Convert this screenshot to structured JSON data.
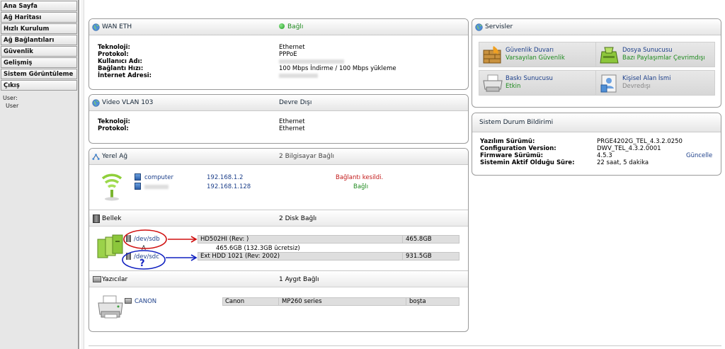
{
  "sidebar": {
    "items": [
      {
        "label": "Ana Sayfa"
      },
      {
        "label": "Ağ Haritası"
      },
      {
        "label": "Hızlı Kurulum"
      },
      {
        "label": "Ağ Bağlantıları"
      },
      {
        "label": "Güvenlik"
      },
      {
        "label": "Gelişmiş"
      },
      {
        "label": "Sistem Görüntüleme"
      },
      {
        "label": "Çıkış"
      }
    ],
    "user_label": "User:",
    "user_value": "User"
  },
  "wan": {
    "title": "WAN ETH",
    "status": "Bağlı",
    "rows": [
      {
        "key": "Teknoloji:",
        "value": "Ethernet"
      },
      {
        "key": "Protokol:",
        "value": "PPPoE"
      },
      {
        "key": "Kullanıcı Adı:",
        "value": ""
      },
      {
        "key": "Bağlantı Hızı:",
        "value": "100 Mbps İndirme / 100 Mbps yükleme"
      },
      {
        "key": "İnternet Adresi:",
        "value": ""
      }
    ]
  },
  "vlan": {
    "title": "Video VLAN 103",
    "status": "Devre Dışı",
    "rows": [
      {
        "key": "Teknoloji:",
        "value": "Ethernet"
      },
      {
        "key": "Protokol:",
        "value": "Ethernet"
      }
    ]
  },
  "lan": {
    "title": "Yerel Ağ",
    "status": "2 Bilgisayar Bağlı",
    "devices": [
      {
        "name": "computer",
        "ip": "192.168.1.2",
        "status": "Bağlantı kesildi."
      },
      {
        "name": "",
        "ip": "192.168.1.128",
        "status": "Bağlı"
      }
    ]
  },
  "storage": {
    "title": "Bellek",
    "status": "2 Disk Bağlı",
    "disks": [
      {
        "path": "/dev/sdb",
        "model": "HD502HI (Rev: )",
        "size": "465.8GB",
        "detail": "465.6GB (132.3GB ücretsiz)",
        "sub": "A"
      },
      {
        "path": "/dev/sdc",
        "model": "Ext HDD 1021 (Rev: 2002)",
        "size": "931.5GB",
        "mark": "?"
      }
    ]
  },
  "printers": {
    "title": "Yazıcılar",
    "status": "1 Aygıt Bağlı",
    "items": [
      {
        "name": "CANON",
        "brand": "Canon",
        "model": "MP260 series",
        "status": "boşta"
      }
    ]
  },
  "services": {
    "title": "Servisler",
    "items": [
      {
        "name": "Güvenlik Duvarı",
        "status": "Varsayılan Güvenlik",
        "icon": "firewall-icon"
      },
      {
        "name": "Dosya Sunucusu",
        "status": "Bazı Paylaşımlar Çevrimdışı",
        "icon": "file-server-icon"
      },
      {
        "name": "Baskı Sunucusu",
        "status": "Etkin",
        "icon": "print-server-icon"
      },
      {
        "name": "Kişisel Alan İsmi",
        "status": "Devredışı",
        "icon": "personal-domain-icon"
      }
    ]
  },
  "system": {
    "title": "Sistem Durum Bildirimi",
    "rows": [
      {
        "key": "Yazılım Sürümü:",
        "value": "PRGE4202G_TEL_4.3.2.0250"
      },
      {
        "key": "Configuration Version:",
        "value": "DWV_TEL_4.3.2.0001"
      },
      {
        "key": "Firmware Sürümü:",
        "value": "4.5.3"
      },
      {
        "key": "Sistemin Aktif Olduğu Süre:",
        "value": "22 saat, 5 dakika"
      }
    ],
    "update_label": "Güncelle"
  },
  "colors": {
    "connected": "#1d8a1d",
    "disconnected": "#c21818",
    "link": "#1c3f8a",
    "annot_red": "#d01010",
    "annot_blue": "#1020c0"
  }
}
